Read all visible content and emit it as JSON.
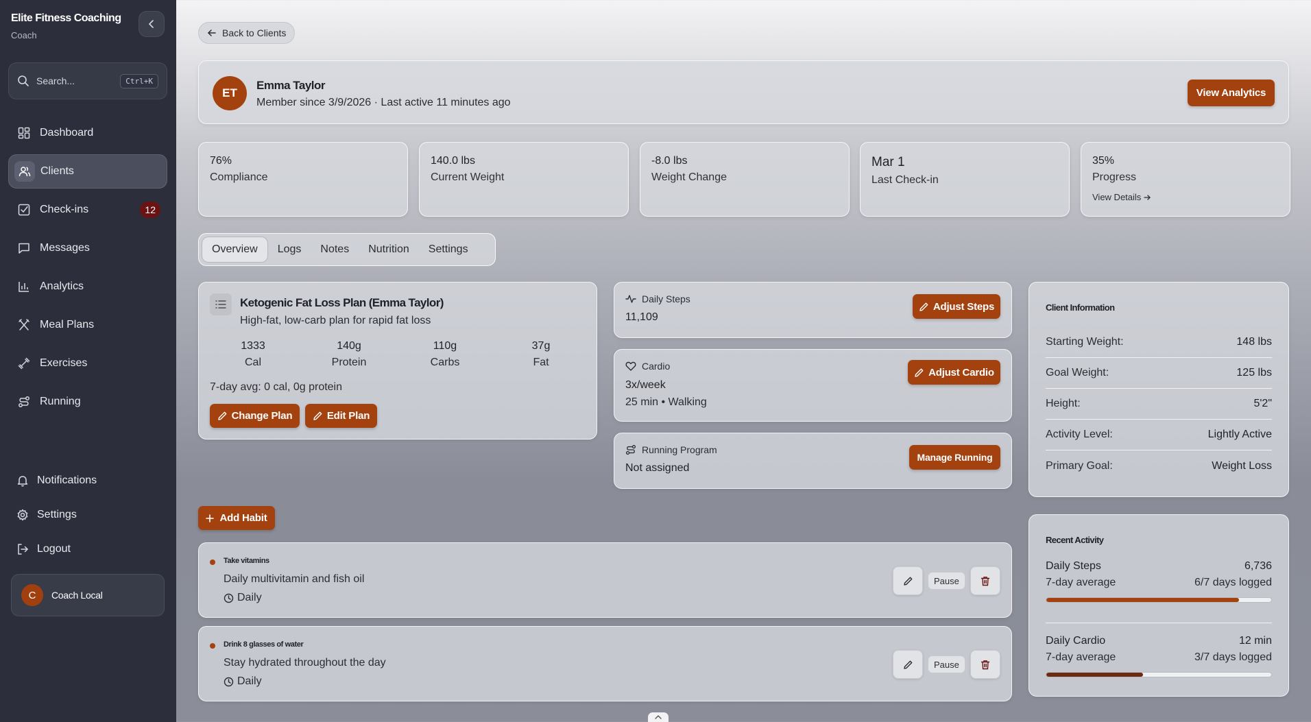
{
  "sidebar": {
    "brand_title": "Elite Fitness Coaching",
    "brand_sub": "Coach",
    "search_placeholder": "Search...",
    "search_shortcut": "Ctrl+K",
    "nav": [
      {
        "label": "Dashboard",
        "icon": "grid-icon"
      },
      {
        "label": "Clients",
        "icon": "users-icon",
        "active": true
      },
      {
        "label": "Check-ins",
        "icon": "checkbox-icon",
        "badge": "12"
      },
      {
        "label": "Messages",
        "icon": "message-icon"
      },
      {
        "label": "Analytics",
        "icon": "bar-chart-icon"
      },
      {
        "label": "Meal Plans",
        "icon": "utensils-icon"
      },
      {
        "label": "Exercises",
        "icon": "dumbbell-icon"
      },
      {
        "label": "Running",
        "icon": "route-icon"
      }
    ],
    "bottom": [
      {
        "label": "Notifications",
        "icon": "bell-icon"
      },
      {
        "label": "Settings",
        "icon": "gear-icon"
      },
      {
        "label": "Logout",
        "icon": "logout-icon"
      }
    ],
    "user": {
      "initial": "C",
      "name": "Coach Local"
    }
  },
  "back_label": "Back to Clients",
  "profile": {
    "initials": "ET",
    "name": "Emma Taylor",
    "meta": "Member since 3/9/2026 · Last active 11 minutes ago",
    "analytics_label": "View Analytics"
  },
  "stats": [
    {
      "value": "76%",
      "label": "Compliance"
    },
    {
      "value": "140.0 lbs",
      "label": "Current Weight"
    },
    {
      "value": "-8.0 lbs",
      "label": "Weight Change"
    },
    {
      "value": "Mar 1",
      "label": "Last Check-in"
    },
    {
      "value": "35%",
      "label": "Progress",
      "link": "View Details"
    }
  ],
  "tabs": [
    "Overview",
    "Logs",
    "Notes",
    "Nutrition",
    "Settings"
  ],
  "plan": {
    "title": "Ketogenic Fat Loss Plan (Emma Taylor)",
    "desc": "High-fat, low-carb plan for rapid fat loss",
    "macros": [
      {
        "value": "1333",
        "label": "Cal"
      },
      {
        "value": "140g",
        "label": "Protein"
      },
      {
        "value": "110g",
        "label": "Carbs"
      },
      {
        "value": "37g",
        "label": "Fat"
      }
    ],
    "avg": "7-day avg: 0 cal, 0g protein",
    "change_label": "Change Plan",
    "edit_label": "Edit Plan"
  },
  "steps": {
    "title": "Daily Steps",
    "value": "11,109",
    "button": "Adjust Steps"
  },
  "cardio": {
    "title": "Cardio",
    "value": "3x/week",
    "sub": "25 min • Walking",
    "button": "Adjust Cardio"
  },
  "running": {
    "title": "Running Program",
    "value": "Not assigned",
    "button": "Manage Running"
  },
  "client_info": {
    "title": "Client Information",
    "rows": [
      {
        "label": "Starting Weight:",
        "value": "148 lbs"
      },
      {
        "label": "Goal Weight:",
        "value": "125 lbs"
      },
      {
        "label": "Height:",
        "value": "5'2\""
      },
      {
        "label": "Activity Level:",
        "value": "Lightly Active"
      },
      {
        "label": "Primary Goal:",
        "value": "Weight Loss"
      }
    ]
  },
  "recent_activity": {
    "title": "Recent Activity",
    "items": [
      {
        "name": "Daily Steps",
        "value": "6,736",
        "sub": "7-day average",
        "logged": "6/7 days logged",
        "progress": 0.857
      },
      {
        "name": "Daily Cardio",
        "value": "12 min",
        "sub": "7-day average",
        "logged": "3/7 days logged",
        "progress": 0.429
      }
    ]
  },
  "add_habit_label": "Add Habit",
  "habits": [
    {
      "name": "Take vitamins",
      "desc": "Daily multivitamin and fish oil",
      "freq": "Daily",
      "pause": "Pause"
    },
    {
      "name": "Drink 8 glasses of water",
      "desc": "Stay hydrated throughout the day",
      "freq": "Daily",
      "pause": "Pause"
    }
  ],
  "colors": {
    "accent": "#a3410f",
    "sidebar": "#2c2f3b",
    "badge": "#6b1313"
  }
}
